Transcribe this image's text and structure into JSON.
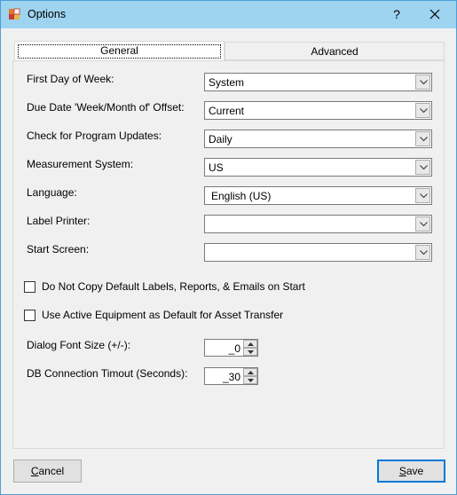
{
  "window": {
    "title": "Options",
    "help_glyph": "?"
  },
  "tabs": [
    {
      "label": "General",
      "active": true
    },
    {
      "label": "Advanced",
      "active": false
    }
  ],
  "general": {
    "first_day_of_week": {
      "label": "First Day of Week:",
      "value": "System"
    },
    "due_date_offset": {
      "label": "Due Date 'Week/Month of' Offset:",
      "value": "Current"
    },
    "program_updates": {
      "label": "Check for Program Updates:",
      "value": "Daily"
    },
    "measurement_system": {
      "label": "Measurement System:",
      "value": "US"
    },
    "language": {
      "label": "Language:",
      "value": "English (US)"
    },
    "label_printer": {
      "label": "Label Printer:",
      "value": ""
    },
    "start_screen": {
      "label": "Start Screen:",
      "value": ""
    },
    "no_copy_defaults": {
      "label": "Do Not Copy Default Labels, Reports, & Emails on Start",
      "checked": false
    },
    "active_equipment_default": {
      "label": "Use Active Equipment as Default for Asset Transfer",
      "checked": false
    },
    "dialog_font_size": {
      "label": "Dialog Font Size (+/-):",
      "value": "_0"
    },
    "db_connection_timeout": {
      "label": "DB Connection Timout (Seconds):",
      "value": "_30"
    }
  },
  "buttons": {
    "cancel_first": "C",
    "cancel_rest": "ancel",
    "save_first": "S",
    "save_rest": "ave"
  },
  "colors": {
    "titlebar": "#9ed4f0",
    "accent": "#0078d7",
    "window_bg": "#f0f0f0"
  }
}
